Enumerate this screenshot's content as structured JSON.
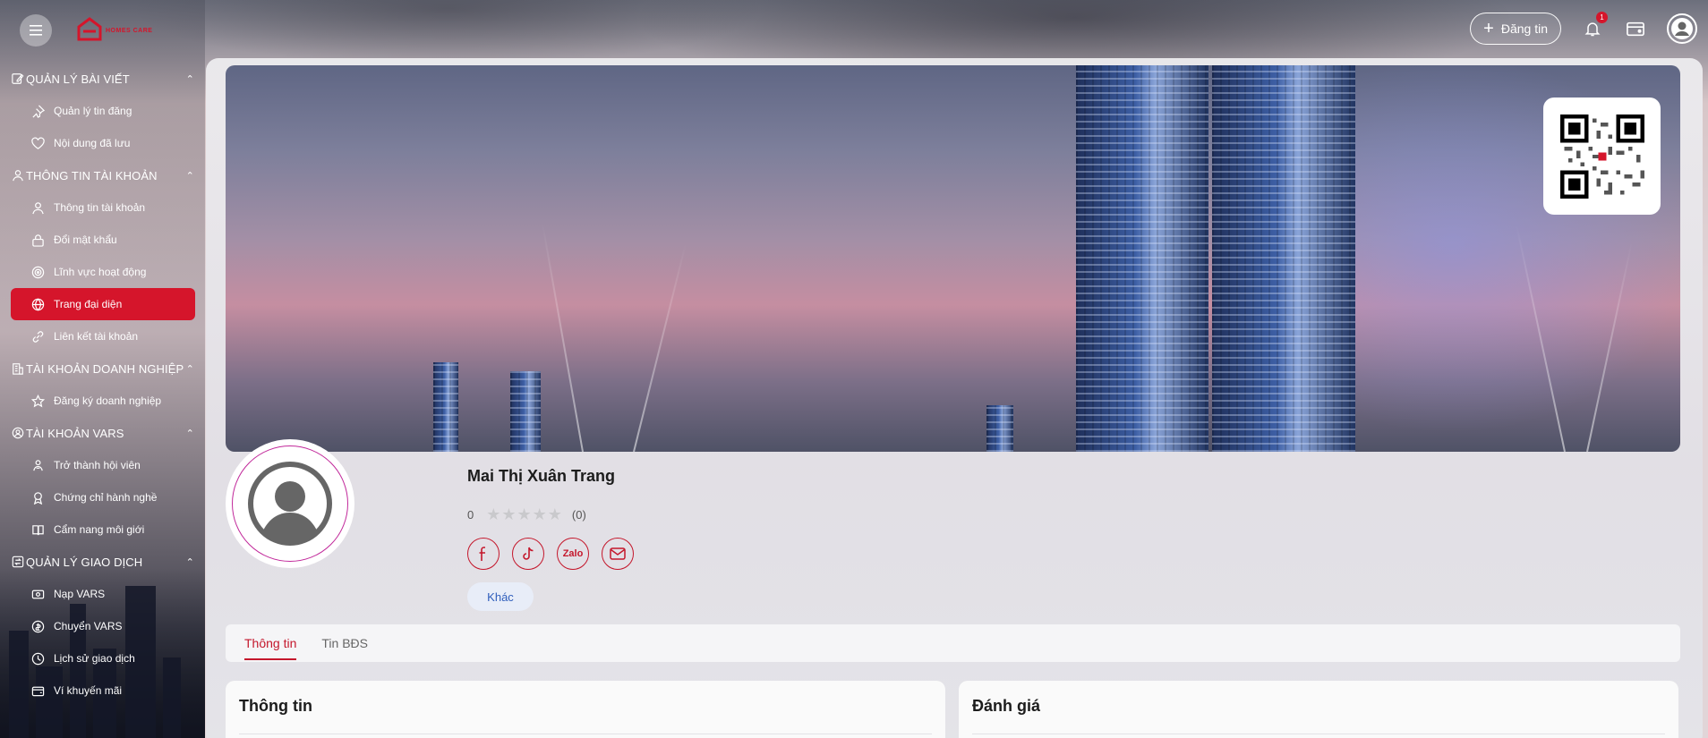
{
  "app": {
    "logo_text": "HOMES CARE",
    "menu_icon": "hamburger-icon"
  },
  "topbar": {
    "post_label": "Đăng tin",
    "notification_count": "1",
    "icons": [
      "bell-icon",
      "wallet-icon",
      "user-avatar-icon"
    ]
  },
  "sidebar": {
    "groups": [
      {
        "label": "QUẢN LÝ BÀI VIẾT",
        "items": [
          {
            "label": "Quản lý tin đăng",
            "icon": "pin-icon"
          },
          {
            "label": "Nội dung đã lưu",
            "icon": "heart-icon"
          }
        ]
      },
      {
        "label": "THÔNG TIN TÀI KHOẢN",
        "items": [
          {
            "label": "Thông tin tài khoản",
            "icon": "user-icon"
          },
          {
            "label": "Đổi mật khẩu",
            "icon": "lock-icon"
          },
          {
            "label": "Lĩnh vực hoạt động",
            "icon": "target-icon"
          },
          {
            "label": "Trang đại diện",
            "icon": "globe-icon",
            "active": true
          },
          {
            "label": "Liên kết tài khoản",
            "icon": "link-icon"
          }
        ]
      },
      {
        "label": "TÀI KHOẢN DOANH NGHIỆP",
        "items": [
          {
            "label": "Đăng ký doanh nghiệp",
            "icon": "star-icon"
          }
        ]
      },
      {
        "label": "TÀI KHOẢN VARS",
        "items": [
          {
            "label": "Trở thành hội viên",
            "icon": "member-icon"
          },
          {
            "label": "Chứng chỉ hành nghề",
            "icon": "certificate-icon"
          },
          {
            "label": "Cẩm nang môi giới",
            "icon": "book-icon"
          }
        ]
      },
      {
        "label": "QUẢN LÝ GIAO DỊCH",
        "items": [
          {
            "label": "Nạp VARS",
            "icon": "deposit-icon"
          },
          {
            "label": "Chuyển VARS",
            "icon": "transfer-icon"
          },
          {
            "label": "Lịch sử giao dịch",
            "icon": "history-icon"
          },
          {
            "label": "Ví khuyến mãi",
            "icon": "promo-wallet-icon"
          }
        ]
      }
    ]
  },
  "profile": {
    "name": "Mai Thị Xuân Trang",
    "rating_value": "0",
    "rating_count": "(0)",
    "stars": "★★★★★",
    "socials": [
      "facebook-icon",
      "tiktok-icon",
      "zalo-icon",
      "email-icon"
    ],
    "zalo_label": "Zalo",
    "other_label": "Khác"
  },
  "tabs": [
    {
      "label": "Thông tin",
      "active": true
    },
    {
      "label": "Tin BĐS",
      "active": false
    }
  ],
  "cards": {
    "info_title": "Thông tin",
    "review_title": "Đánh giá"
  },
  "colors": {
    "accent": "#d5152b",
    "link": "#2f5ebc"
  }
}
